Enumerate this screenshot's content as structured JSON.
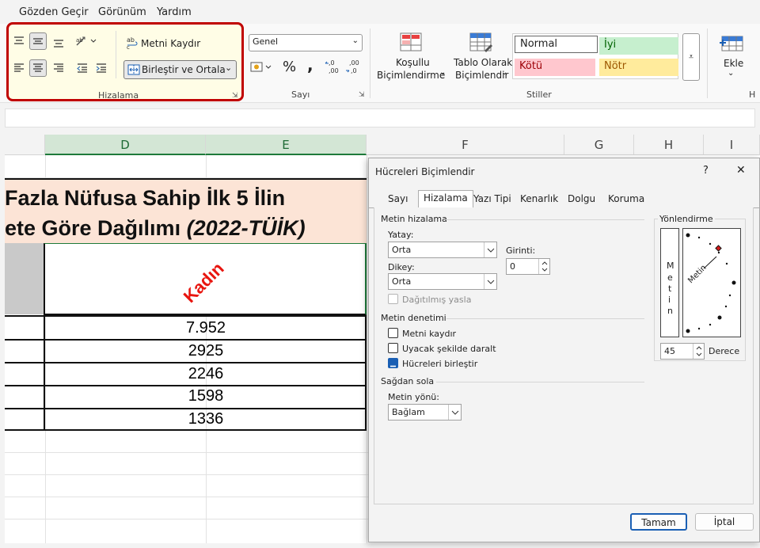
{
  "menu": [
    "Gözden Geçir",
    "Görünüm",
    "Yardım"
  ],
  "ribbon": {
    "alignment": {
      "wrap_text": "Metni Kaydır",
      "merge_center": "Birleştir ve Ortala",
      "group_label": "Hizalama"
    },
    "number": {
      "format": "Genel",
      "percent": "%",
      "comma": ",",
      "inc_decimals": ",0\n,00",
      "dec_decimals": ",00\n,0",
      "group_label": "Sayı"
    },
    "styles": {
      "conditional": [
        "Koşullu",
        "Biçimlendirme"
      ],
      "format_table": [
        "Tablo Olarak",
        "Biçimlendir"
      ],
      "cell_styles": [
        {
          "label": "Normal",
          "color": "#ffffff"
        },
        {
          "label": "İyi",
          "color": "#c6efce"
        },
        {
          "label": "Kötü",
          "color": "#ffc7ce"
        },
        {
          "label": "Nötr",
          "color": "#ffeb9c"
        }
      ],
      "group_label": "Stiller"
    },
    "cells": {
      "insert": "Ekle",
      "group_label_partial": "H"
    }
  },
  "sheet": {
    "columns": [
      "D",
      "E",
      "F",
      "G",
      "H",
      "I"
    ],
    "title_line1": "Fazla Nüfusa Sahip İlk 5 İlin",
    "title_line2": "ete Göre Dağılımı ",
    "title_line2_italic": "(2022-TÜİK)",
    "header": "Kadın",
    "values": [
      "7.952",
      "2925",
      "2246",
      "1598",
      "1336"
    ],
    "accent_color": "#e8150f"
  },
  "dialog": {
    "title": "Hücreleri Biçimlendir",
    "help": "?",
    "close": "✕",
    "tabs": [
      "Sayı",
      "Hizalama",
      "Yazı Tipi",
      "Kenarlık",
      "Dolgu",
      "Koruma"
    ],
    "active_tab": "Hizalama",
    "alignment_section": "Metin hizalama",
    "horizontal_label": "Yatay:",
    "horizontal_value": "Orta",
    "vertical_label": "Dikey:",
    "vertical_value": "Orta",
    "indent_label": "Girinti:",
    "indent_value": "0",
    "distributed": "Dağıtılmış yasla",
    "control_section": "Metin denetimi",
    "wrap": "Metni kaydır",
    "shrink": "Uyacak şekilde daralt",
    "merge": "Hücreleri birleştir",
    "rtl_section": "Sağdan sola",
    "direction_label": "Metin yönü:",
    "direction_value": "Bağlam",
    "orientation_section": "Yönlendirme",
    "vertical_text": [
      "M",
      "e",
      "t",
      "i",
      "n"
    ],
    "dial_text": "Metin",
    "degrees_value": "45",
    "degrees_label": "Derece",
    "ok": "Tamam",
    "cancel": "İptal"
  }
}
